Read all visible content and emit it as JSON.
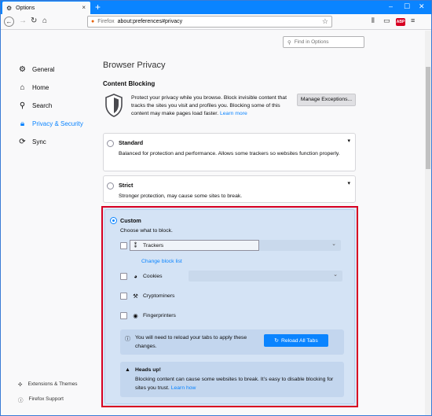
{
  "window": {
    "tab_title": "Options",
    "url_prefix": "Firefox",
    "url": "about:preferences#privacy",
    "minimize": "–",
    "maximize": "☐",
    "close": "✕"
  },
  "search": {
    "placeholder": "Find in Options"
  },
  "sidebar": {
    "items": [
      {
        "label": "General",
        "icon": "gear-icon"
      },
      {
        "label": "Home",
        "icon": "home-icon"
      },
      {
        "label": "Search",
        "icon": "search-icon"
      },
      {
        "label": "Privacy & Security",
        "icon": "lock-icon",
        "active": true
      },
      {
        "label": "Sync",
        "icon": "sync-icon"
      }
    ],
    "footer": [
      {
        "label": "Extensions & Themes",
        "icon": "puzzle-icon"
      },
      {
        "label": "Firefox Support",
        "icon": "help-icon"
      }
    ]
  },
  "main": {
    "title": "Browser Privacy",
    "section": "Content Blocking",
    "description": "Protect your privacy while you browse. Block invisible content that tracks the sites you visit and profiles you. Blocking some of this content may make pages load faster.",
    "learn_more": "Learn more",
    "manage_button": "Manage Exceptions...",
    "standard": {
      "title": "Standard",
      "description": "Balanced for protection and performance. Allows some trackers so websites function properly."
    },
    "strict": {
      "title": "Strict",
      "description": "Stronger protection, may cause some sites to break."
    },
    "custom": {
      "title": "Custom",
      "subtitle": "Choose what to block.",
      "options": [
        {
          "label": "Trackers",
          "checked": false
        },
        {
          "label": "Cookies",
          "checked": false
        },
        {
          "label": "Cryptominers",
          "checked": false
        },
        {
          "label": "Fingerprinters",
          "checked": false
        }
      ],
      "change_block_list": "Change block list",
      "reload_message": "You will need to reload your tabs to apply these changes.",
      "reload_button": "Reload All Tabs",
      "warning_title": "Heads up!",
      "warning_text": "Blocking content can cause some websites to break. It’s easy to disable blocking for sites you trust.",
      "warning_link": "Learn how"
    }
  },
  "colors": {
    "accent": "#0a84ff",
    "highlight_border": "#d70022"
  }
}
